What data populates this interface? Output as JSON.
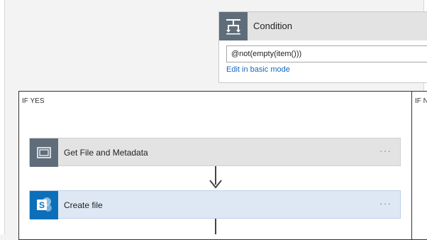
{
  "condition": {
    "title": "Condition",
    "expression": "@not(empty(item()))",
    "edit_link": "Edit in basic mode",
    "icon": "condition-icon"
  },
  "branches": {
    "yes_label": "IF YES",
    "no_label": "IF NO"
  },
  "actions": [
    {
      "title": "Get File and Metadata",
      "more": "···",
      "icon": "file-metadata-icon"
    },
    {
      "title": "Create file",
      "more": "···",
      "icon": "sharepoint-icon"
    }
  ],
  "colors": {
    "condition_icon_bg": "#5f6d7a",
    "sharepoint_icon_bg": "#0b6fba",
    "link": "#1568c0",
    "create_card_bg": "#dde8f4"
  }
}
